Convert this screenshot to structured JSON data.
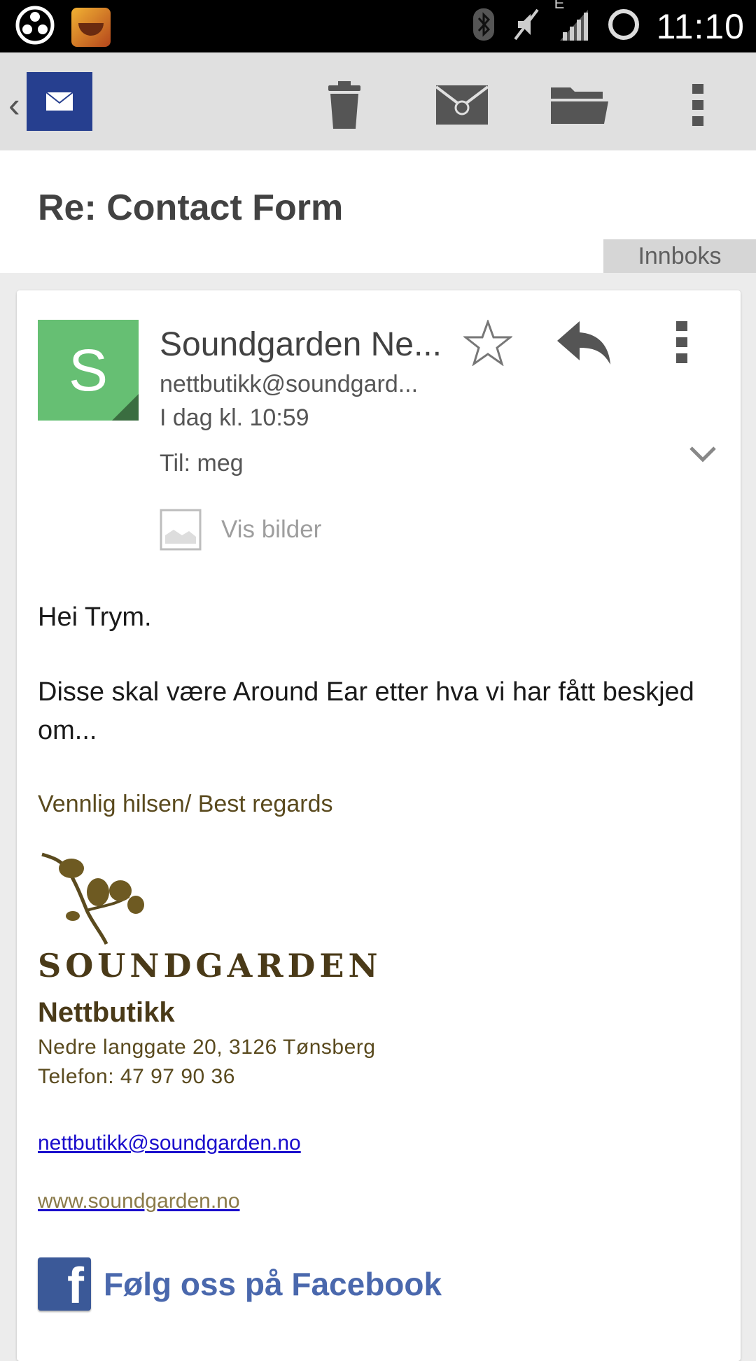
{
  "status_bar": {
    "time": "11:10",
    "network_type": "E",
    "icons": [
      "app-hub-icon",
      "clash-of-clans-icon",
      "bluetooth-icon",
      "mute-icon",
      "signal-icon",
      "sync-icon"
    ]
  },
  "action_bar": {
    "back_glyph": "‹",
    "actions": [
      "delete-icon",
      "mark-unread-icon",
      "move-to-folder-icon",
      "overflow-menu-icon"
    ]
  },
  "subject": {
    "title": "Re: Contact Form",
    "label": "Innboks"
  },
  "message": {
    "avatar_letter": "S",
    "sender_name": "Soundgarden Ne...",
    "sender_email": "nettbutikk@soundgard...",
    "time": "I dag kl. 10:59",
    "recipients": "Til: meg",
    "show_images_label": "Vis bilder",
    "greeting": "Hei Trym.",
    "body": "Disse skal være Around Ear etter hva vi har fått beskjed om...",
    "signoff": "Vennlig hilsen/ Best regards"
  },
  "signature": {
    "logo_text": "SOUNDGARDEN",
    "company": "Nettbutikk",
    "address": "Nedre langgate 20, 3126 Tønsberg",
    "phone": "Telefon: 47 97 90 36",
    "email": "nettbutikk@soundgarden.no",
    "website": "www.soundgarden.no",
    "facebook_text": "Følg oss på Facebook"
  },
  "colors": {
    "avatar": "#66bf73",
    "app_logo": "#263f8f",
    "signature_brown": "#5a4a1e",
    "link_blue": "#1a0dcc",
    "facebook_blue": "#3b5998"
  }
}
